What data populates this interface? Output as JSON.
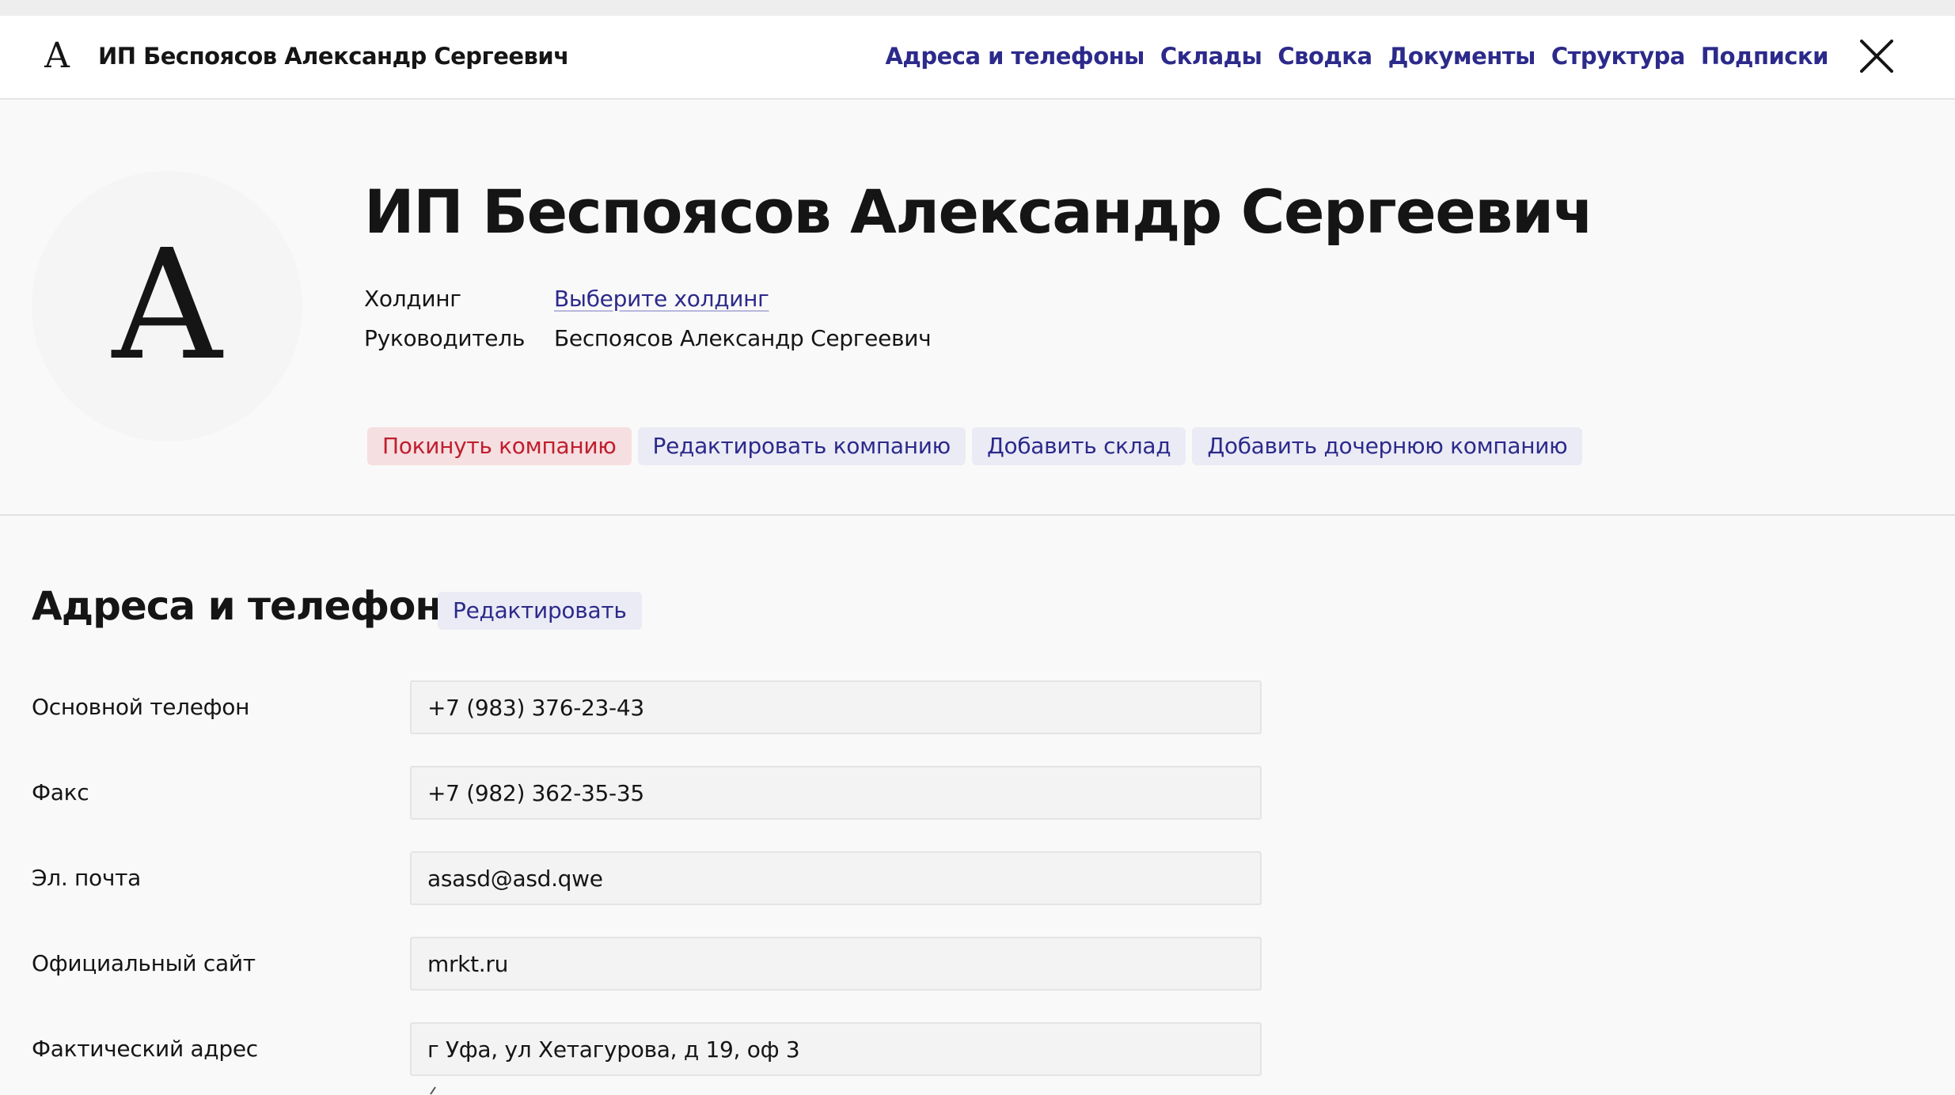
{
  "topbar": {
    "avatar_letter": "A",
    "title": "ИП Беспоясов Александр Сергеевич",
    "nav": [
      "Адреса и телефоны",
      "Склады",
      "Сводка",
      "Документы",
      "Структура",
      "Подписки"
    ],
    "close_icon": "close-icon"
  },
  "company": {
    "avatar_letter": "A",
    "name": "ИП Беспоясов Александр Сергеевич",
    "holding_label": "Холдинг",
    "holding_value": "Выберите холдинг",
    "manager_label": "Руководитель",
    "manager_value": "Беспоясов Александр Сергеевич",
    "actions": {
      "leave": "Покинуть компанию",
      "edit": "Редактировать компанию",
      "add_warehouse": "Добавить склад",
      "add_subsidiary": "Добавить дочернюю компанию"
    }
  },
  "contacts": {
    "title": "Адреса и телефоны",
    "edit_label": "Редактировать",
    "fields": [
      {
        "label": "Основной телефон",
        "value": "+7 (983) 376-23-43"
      },
      {
        "label": "Факс",
        "value": "+7 (982) 362-35-35"
      },
      {
        "label": "Эл. почта",
        "value": "asasd@asd.qwe"
      },
      {
        "label": "Официальный сайт",
        "value": "mrkt.ru"
      },
      {
        "label": "Фактический адрес",
        "value": "г Уфа, ул Хетагурова, д 19, оф 3"
      }
    ]
  },
  "colors": {
    "accent": "#2c2a8a",
    "danger": "#bf1e2e",
    "danger_bg": "#f6dfe0",
    "soft_bg": "#ebebf6",
    "page_bg": "#f9f9f9"
  }
}
